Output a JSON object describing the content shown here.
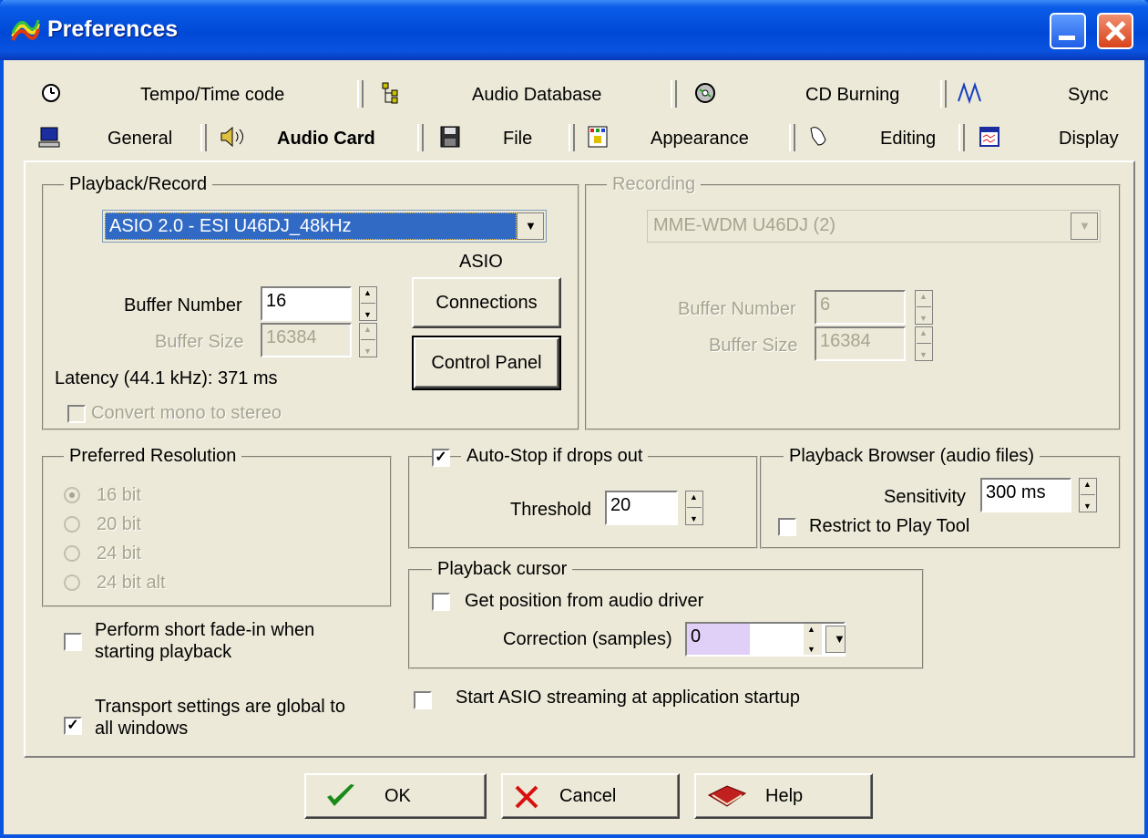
{
  "window": {
    "title": "Preferences"
  },
  "tabs_row1": [
    {
      "label": "Tempo/Time code",
      "icon": "clock-icon"
    },
    {
      "label": "Audio Database",
      "icon": "tree-icon"
    },
    {
      "label": "CD Burning",
      "icon": "cd-icon"
    },
    {
      "label": "Sync",
      "icon": "sync-wave-icon"
    }
  ],
  "tabs_row2": [
    {
      "label": "General",
      "icon": "computer-icon"
    },
    {
      "label": "Audio Card",
      "icon": "speaker-icon",
      "active": true
    },
    {
      "label": "File",
      "icon": "floppy-icon"
    },
    {
      "label": "Appearance",
      "icon": "palette-icon"
    },
    {
      "label": "Editing",
      "icon": "mouse-icon"
    },
    {
      "label": "Display",
      "icon": "display-icon"
    }
  ],
  "playback_record": {
    "title": "Playback/Record",
    "device": "ASIO 2.0 - ESI U46DJ_48kHz",
    "asio_label": "ASIO",
    "connections_button": "Connections",
    "control_panel_button": "Control Panel",
    "buffer_number_label": "Buffer Number",
    "buffer_number": "16",
    "buffer_size_label": "Buffer Size",
    "buffer_size": "16384",
    "latency": "Latency (44.1 kHz): 371 ms",
    "convert_mono": "Convert mono to stereo"
  },
  "recording": {
    "title": "Recording",
    "device": "MME-WDM U46DJ (2)",
    "buffer_number_label": "Buffer Number",
    "buffer_number": "6",
    "buffer_size_label": "Buffer Size",
    "buffer_size": "16384"
  },
  "preferred_resolution": {
    "title": "Preferred Resolution",
    "options": [
      "16 bit",
      "20 bit",
      "24 bit",
      "24 bit alt"
    ],
    "selected": "16 bit"
  },
  "fade_in": {
    "line1": "Perform short fade-in when",
    "line2": "starting playback",
    "checked": false
  },
  "transport": {
    "line1": "Transport settings are global to",
    "line2": "all windows",
    "checked": true
  },
  "auto_stop": {
    "label": "Auto-Stop if drops out",
    "checked": true,
    "threshold_label": "Threshold",
    "threshold": "20"
  },
  "playback_browser": {
    "title": "Playback Browser (audio files)",
    "sensitivity_label": "Sensitivity",
    "sensitivity": "300 ms",
    "restrict": "Restrict to Play Tool",
    "restrict_checked": false
  },
  "playback_cursor": {
    "title": "Playback cursor",
    "get_position": "Get position from audio driver",
    "get_position_checked": false,
    "correction_label": "Correction (samples)",
    "correction": "0"
  },
  "asio_startup": {
    "label": "Start ASIO streaming at application startup",
    "checked": false
  },
  "buttons": {
    "ok": "OK",
    "cancel": "Cancel",
    "help": "Help"
  },
  "colors": {
    "title_bar": "#0054e3",
    "selection": "#316ac5",
    "dialog_bg": "#ece9d8"
  }
}
